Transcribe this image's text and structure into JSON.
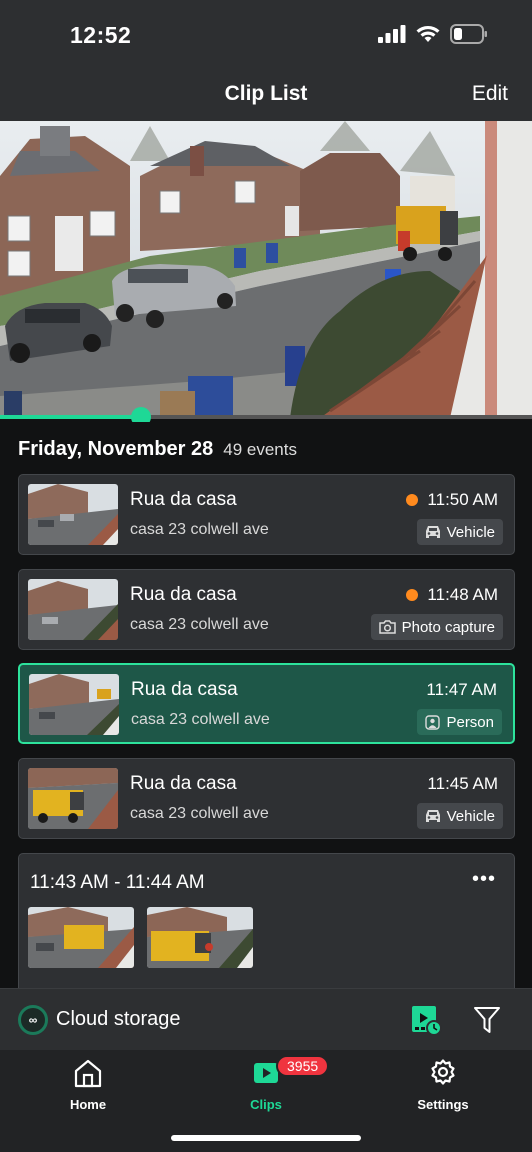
{
  "status": {
    "time": "12:52"
  },
  "header": {
    "title": "Clip List",
    "edit_label": "Edit"
  },
  "player": {
    "progress_percent": 26.5
  },
  "list": {
    "date": "Friday, November 28",
    "count": "49 events",
    "clips": [
      {
        "title": "Rua da casa",
        "subtitle": "casa 23 colwell ave",
        "time": "11:50 AM",
        "badge": "Vehicle",
        "badge_icon": "car-icon",
        "unread": true
      },
      {
        "title": "Rua da casa",
        "subtitle": "casa 23 colwell ave",
        "time": "11:48 AM",
        "badge": "Photo capture",
        "badge_icon": "camera-icon",
        "unread": true
      },
      {
        "title": "Rua da casa",
        "subtitle": "casa 23 colwell ave",
        "time": "11:47 AM",
        "badge": "Person",
        "badge_icon": "person-icon",
        "unread": false,
        "selected": true
      },
      {
        "title": "Rua da casa",
        "subtitle": "casa 23 colwell ave",
        "time": "11:45 AM",
        "badge": "Vehicle",
        "badge_icon": "car-icon",
        "unread": false
      }
    ],
    "group": {
      "range": "11:43 AM - 11:44 AM",
      "more": "•••"
    }
  },
  "cloud": {
    "label": "Cloud storage",
    "icon_text": "∞"
  },
  "tabs": [
    {
      "label": "Home",
      "icon": "home-icon"
    },
    {
      "label": "Clips",
      "icon": "clips-icon",
      "badge": "3955",
      "active": true
    },
    {
      "label": "Settings",
      "icon": "gear-icon"
    }
  ],
  "colors": {
    "accent": "#1ed896",
    "selected_bg": "#1e5748",
    "unread_dot": "#ff8a1e",
    "badge_red": "#f0343f"
  }
}
